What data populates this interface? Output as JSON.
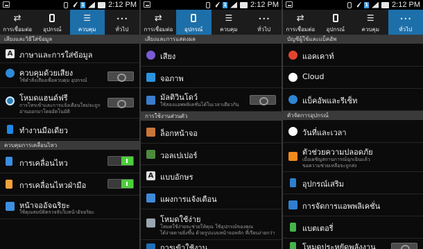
{
  "statusbar": {
    "time": "2:12 PM",
    "sim_label": "1"
  },
  "panels": [
    {
      "tabs": [
        {
          "label": "การเชื่อมต่อ",
          "icon": "sync-icon"
        },
        {
          "label": "อุปกรณ์",
          "icon": "phone-icon"
        },
        {
          "label": "ควบคุม",
          "icon": "sliders-icon"
        },
        {
          "label": "ทั่วไป",
          "icon": "more-icon"
        }
      ],
      "active_tab": 2,
      "section_1": "เสียงและวิธีใส่ข้อมูล",
      "items": [
        {
          "title": "ภาษาและการใส่ข้อมูล",
          "icon_text": "A"
        },
        {
          "title": "ควบคุมด้วยเสียง",
          "sub": "ใช้คำสั่งเสียงเพื่อควบคุม อุปกรณ์",
          "toggle": "off"
        },
        {
          "title": "โหมดแฮนด์ฟรี",
          "sub_1": "การโทรเข้าและการแจ้งเตือนใหม่จะถูก",
          "sub_2": "อ่านออกมาโดยอัตโนมัติ",
          "toggle": "off"
        },
        {
          "title": "ทำงานมือเดียว"
        }
      ],
      "section_2": "ควบคุมการเคลื่อนไหว",
      "items_2": [
        {
          "title": "การเคลื่อนไหว",
          "toggle": "on"
        },
        {
          "title": "การเคลื่อนไหวฝ่ามือ",
          "toggle": "on"
        },
        {
          "title": "หน้าจออัจฉริยะ",
          "sub": "ใช้คุณสมบัติตรวจจับใบหน้าอัจฉริยะ"
        }
      ]
    },
    {
      "tabs": [
        {
          "label": "การเชื่อมต่อ",
          "icon": "sync-icon"
        },
        {
          "label": "อุปกรณ์",
          "icon": "phone-icon"
        },
        {
          "label": "ควบคุม",
          "icon": "sliders-icon"
        },
        {
          "label": "ทั่วไป",
          "icon": "more-icon"
        }
      ],
      "active_tab": 1,
      "section_1": "เสียงและการแสดงผล",
      "items": [
        {
          "title": "เสียง"
        },
        {
          "title": "จอภาพ"
        },
        {
          "title": "มัลติวินโดว์",
          "sub": "ใช้สองแอพพลิเคชั่นได้ในเวลาเดียวกัน",
          "toggle": "off"
        }
      ],
      "section_2": "การใช้งานส่วนตัว",
      "items_2": [
        {
          "title": "ล็อกหน้าจอ"
        },
        {
          "title": "วอลเปเปอร์"
        },
        {
          "title": "แบบอักษร",
          "icon_text": "A"
        },
        {
          "title": "แผงการแจ้งเตือน"
        },
        {
          "title": "โหมดใช้ง่าย",
          "sub_1": "โหมดใช้ง่ายจะช่วยให้คุณ ใช้อุปกรณ์ของคุณ",
          "sub_2": "ได้ง่ายดายยิ่งขึ้น ด้วยรูปแบบหน้าจอหลัก ที่เรียบง่ายกว่า"
        },
        {
          "title": "การเข้าใช้งาน"
        }
      ]
    },
    {
      "tabs": [
        {
          "label": "การเชื่อมต่อ",
          "icon": "sync-icon"
        },
        {
          "label": "อุปกรณ์",
          "icon": "phone-icon"
        },
        {
          "label": "ควบคุม",
          "icon": "sliders-icon"
        },
        {
          "label": "ทั่วไป",
          "icon": "more-icon"
        }
      ],
      "active_tab": 3,
      "section_1": "บัญชีผู้ใช้และแบ็คอัพ",
      "items": [
        {
          "title": "แอคเคาท์"
        },
        {
          "title": "Cloud"
        },
        {
          "title": "แบ็คอัพและรีเซ็ท"
        }
      ],
      "section_2": "ตัวจัดการอุปกรณ์",
      "items_2": [
        {
          "title": "วันที่และเวลา"
        },
        {
          "title": "ตัวช่วยความปลอดภัย",
          "sub_1": "เมื่อเผชิญสถานการณ์ฉุกเฉินแล้ว",
          "sub_2": "ขอความช่วยเหลือจะถูกส่ง"
        },
        {
          "title": "อุปกรณ์เสริม"
        },
        {
          "title": "การจัดการแอพพลิเคชั่น"
        },
        {
          "title": "แบตเตอรี่"
        },
        {
          "title": "โหมดประหยัดพลังงาน"
        }
      ]
    }
  ]
}
